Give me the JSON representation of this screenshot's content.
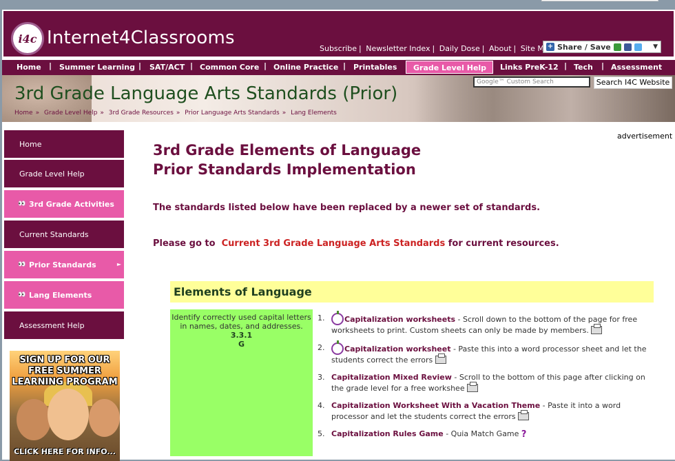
{
  "header": {
    "logo_badge": "i4c",
    "brand": "Internet4Classrooms",
    "top_links": [
      "Subscribe",
      "Newsletter Index",
      "Daily Dose",
      "About",
      "Site Map"
    ],
    "share_label": "Share / Save"
  },
  "nav": {
    "items": [
      "Home",
      "Summer Learning",
      "SAT/ACT",
      "Common Core",
      "Online Practice",
      "Printables",
      "Grade Level Help",
      "Links PreK-12",
      "Tech",
      "Assessment"
    ],
    "active": "Grade Level Help"
  },
  "banner": {
    "title": "3rd Grade Language Arts Standards (Prior)",
    "breadcrumbs": [
      "Home",
      "Grade Level Help",
      "3rd Grade Resources",
      "Prior Language Arts Standards",
      "Lang Elements"
    ],
    "search_placeholder": "Google™ Custom Search",
    "search_button": "Search I4C Website"
  },
  "sidebar": {
    "items": [
      {
        "label": "Home",
        "style": "dark"
      },
      {
        "label": "Grade Level Help",
        "style": "dark"
      },
      {
        "label": "3rd Grade Activities",
        "style": "pink"
      },
      {
        "label": "Current Standards",
        "style": "dark"
      },
      {
        "label": "Prior Standards",
        "style": "pink"
      },
      {
        "label": "Lang Elements",
        "style": "pink"
      },
      {
        "label": "Assessment Help",
        "style": "dark"
      }
    ],
    "ad_headline": "SIGN UP FOR OUR FREE SUMMER LEARNING PROGRAM",
    "ad_cta": "CLICK HERE FOR INFO..."
  },
  "main": {
    "advertisement": "advertisement",
    "heading_line1": "3rd Grade Elements of Language",
    "heading_line2": "Prior Standards Implementation",
    "notice": "The standards listed below have been replaced by a newer set of standards.",
    "goto_prefix": "Please go to",
    "goto_link": "Current 3rd Grade Language Arts Standards",
    "goto_suffix": "for current resources.",
    "section_title": "Elements of Language",
    "standard_text": "Identify correctly used capital letters in names, dates, and addresses.",
    "standard_code": "3.3.1",
    "standard_level": "G",
    "resources": [
      {
        "num": "1.",
        "title": "Capitalization worksheets",
        "desc": " - Scroll down to the bottom of the page for free worksheets to print. Custom sheets can only be made by members."
      },
      {
        "num": "2.",
        "title": "Capitalization worksheet",
        "desc": " - Paste this into a word processor sheet and let the students correct the errors"
      },
      {
        "num": "3.",
        "title": "Capitalization Mixed Review",
        "desc": " - Scroll to the bottom of this page after clicking on the grade level for a free workshee"
      },
      {
        "num": "4.",
        "title": "Capitalization Worksheet With a Vacation Theme",
        "desc": "  - Paste it into a word processor and let the students correct the errors"
      },
      {
        "num": "5.",
        "title": "Capitalization Rules Game",
        "desc": " - Quia Match Game"
      }
    ]
  }
}
